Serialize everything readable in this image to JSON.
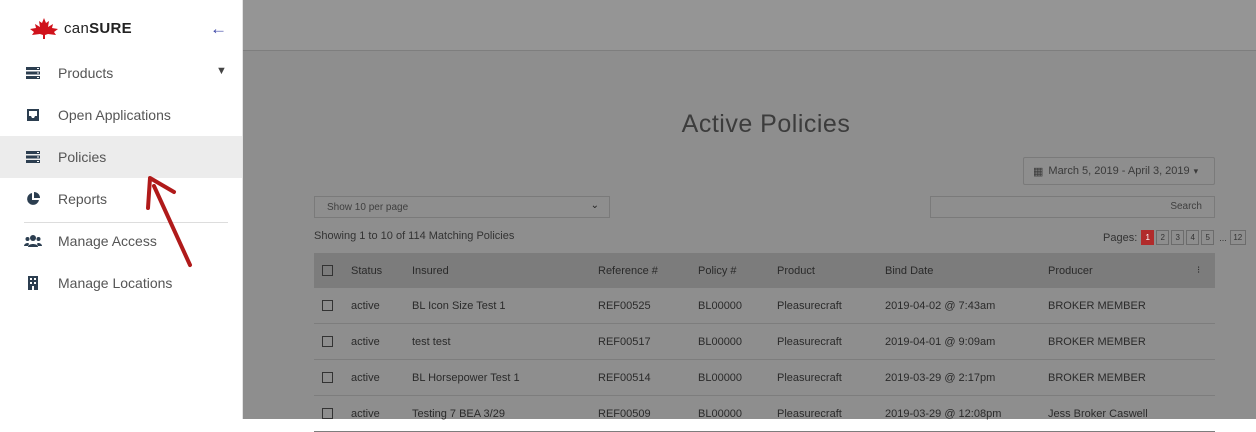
{
  "app": {
    "brand_light": "can",
    "brand_bold": "SURE",
    "brand_color": "#d0121b"
  },
  "sidebar": {
    "items": [
      {
        "label": "Products",
        "icon": "server-icon"
      },
      {
        "label": "Open Applications",
        "icon": "inbox-icon"
      },
      {
        "label": "Policies",
        "icon": "server-icon"
      },
      {
        "label": "Reports",
        "icon": "pie-chart-icon"
      },
      {
        "label": "Manage Access",
        "icon": "users-icon"
      },
      {
        "label": "Manage Locations",
        "icon": "building-icon"
      }
    ]
  },
  "main": {
    "title": "Active Policies",
    "date_range": "March 5, 2019 - April 3, 2019",
    "page_size": "Show 10 per page",
    "search_placeholder": "Search",
    "showing": "Showing 1 to 10 of 114 Matching Policies",
    "pages_label": "Pages:",
    "pages": [
      "1",
      "2",
      "3",
      "4",
      "5"
    ],
    "pages_ellipsis": "...",
    "last_page": "12",
    "accent": "#b12b2b"
  },
  "table": {
    "headers": {
      "status": "Status",
      "insured": "Insured",
      "ref": "Reference #",
      "policy": "Policy #",
      "product": "Product",
      "bind": "Bind Date",
      "producer": "Producer",
      "more": "⁝"
    },
    "rows": [
      {
        "status": "active",
        "insured": "BL Icon Size Test 1",
        "ref": "REF00525",
        "policy": "BL00000",
        "product": "Pleasurecraft",
        "bind": "2019-04-02 @ 7:43am",
        "producer": "BROKER MEMBER"
      },
      {
        "status": "active",
        "insured": "test test",
        "ref": "REF00517",
        "policy": "BL00000",
        "product": "Pleasurecraft",
        "bind": "2019-04-01 @ 9:09am",
        "producer": "BROKER MEMBER"
      },
      {
        "status": "active",
        "insured": "BL Horsepower Test 1",
        "ref": "REF00514",
        "policy": "BL00000",
        "product": "Pleasurecraft",
        "bind": "2019-03-29 @ 2:17pm",
        "producer": "BROKER MEMBER"
      },
      {
        "status": "active",
        "insured": "Testing 7 BEA 3/29",
        "ref": "REF00509",
        "policy": "BL00000",
        "product": "Pleasurecraft",
        "bind": "2019-03-29 @ 12:08pm",
        "producer": "Jess Broker Caswell"
      }
    ]
  }
}
